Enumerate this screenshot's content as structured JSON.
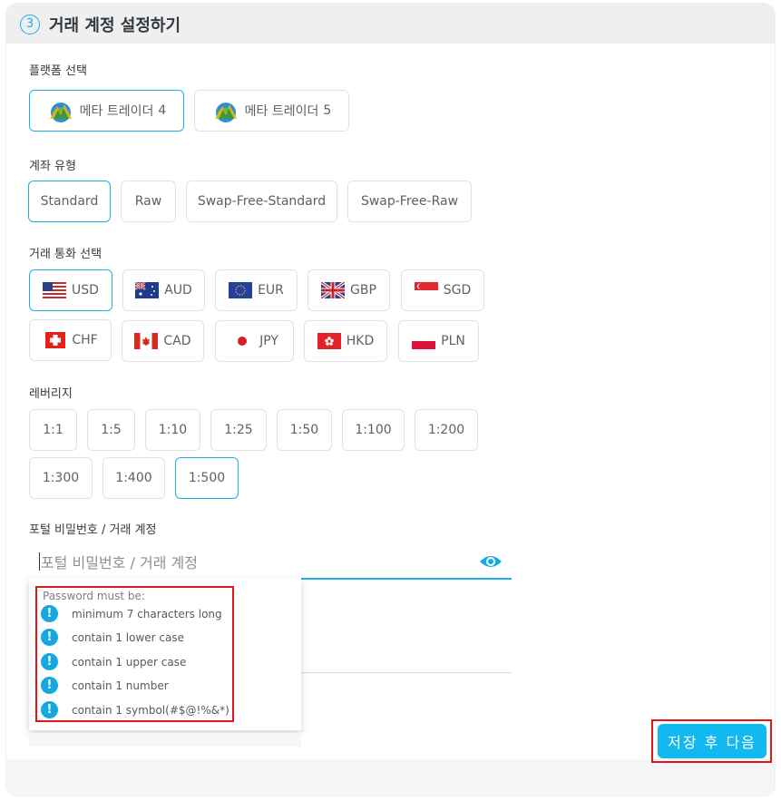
{
  "step": {
    "number": "3",
    "title": "거래 계정 설정하기"
  },
  "platform": {
    "label": "플랫폼 선택",
    "options": [
      {
        "name": "메타 트레이더",
        "version": "4",
        "selected": true
      },
      {
        "name": "메타 트레이더",
        "version": "5",
        "selected": false
      }
    ]
  },
  "account_type": {
    "label": "계좌 유형",
    "options": [
      "Standard",
      "Raw",
      "Swap-Free-Standard",
      "Swap-Free-Raw"
    ],
    "selected": "Standard"
  },
  "currency": {
    "label": "거래 통화 선택",
    "options": [
      "USD",
      "AUD",
      "EUR",
      "GBP",
      "SGD",
      "CHF",
      "CAD",
      "JPY",
      "HKD",
      "PLN"
    ],
    "selected": "USD"
  },
  "leverage": {
    "label": "레버리지",
    "options": [
      "1:1",
      "1:5",
      "1:10",
      "1:25",
      "1:50",
      "1:100",
      "1:200",
      "1:300",
      "1:400",
      "1:500"
    ],
    "selected": "1:500"
  },
  "password": {
    "label": "포털 비밀번호 / 거래 계정",
    "placeholder": "포털 비밀번호 / 거래 계정",
    "requirements_title": "Password must be:",
    "requirements": [
      "minimum 7 characters long",
      "contain 1 lower case",
      "contain 1 upper case",
      "contain 1 number",
      "contain 1 symbol(#$@!%&*)"
    ],
    "requirement_icon": "exclamation-icon",
    "visibility_icon": "eye-icon"
  },
  "save_button": {
    "label": "저장 후 다음"
  },
  "colors": {
    "accent": "#1ab2e6",
    "highlight": "#e0161a",
    "button": "#12b8f0"
  }
}
